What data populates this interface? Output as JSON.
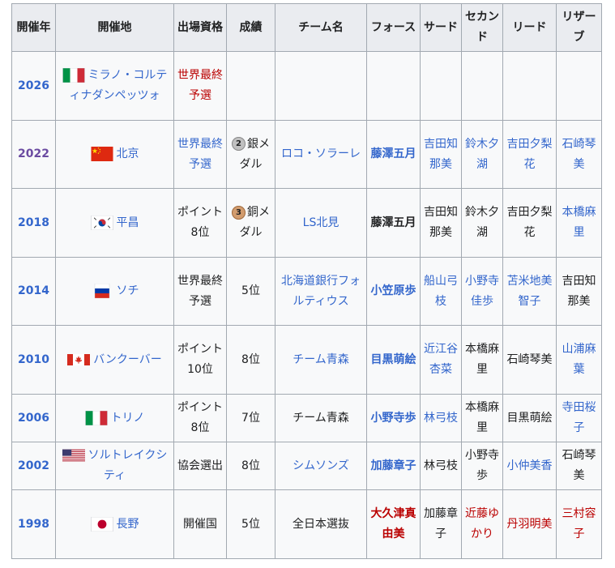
{
  "headers": [
    "開催年",
    "開催地",
    "出場資格",
    "成績",
    "チーム名",
    "フォース",
    "サード",
    "セカンド",
    "リード",
    "リザーブ"
  ],
  "rows": [
    {
      "year": "2026",
      "flag": "italy-flag-icon",
      "venue": "ミラノ・コルティナダンペッツォ",
      "qual": "世界最終予選",
      "result": "",
      "medal": "",
      "team": "",
      "fourth": "",
      "third": "",
      "second": "",
      "lead": "",
      "reserve": ""
    },
    {
      "year": "2022",
      "flag": "china-flag-icon",
      "venue": "北京",
      "qual": "世界最終予選",
      "result": "銀メダル",
      "medal": "2",
      "team": "ロコ・ソラーレ",
      "fourth": "藤澤五月",
      "third": "吉田知那美",
      "second": "鈴木夕湖",
      "lead": "吉田夕梨花",
      "reserve": "石崎琴美"
    },
    {
      "year": "2018",
      "flag": "korea-flag-icon",
      "venue": "平昌",
      "qual": "ポイント8位",
      "result": "銅メダル",
      "medal": "3",
      "team": "LS北見",
      "fourth": "藤澤五月",
      "third": "吉田知那美",
      "second": "鈴木夕湖",
      "lead": "吉田夕梨花",
      "reserve": "本橋麻里"
    },
    {
      "year": "2014",
      "flag": "russia-flag-icon",
      "venue": "ソチ",
      "qual": "世界最終予選",
      "result": "5位",
      "medal": "",
      "team": "北海道銀行フォルティウス",
      "fourth": "小笠原歩",
      "third": "船山弓枝",
      "second": "小野寺佳歩",
      "lead": "苫米地美智子",
      "reserve": "吉田知那美"
    },
    {
      "year": "2010",
      "flag": "canada-flag-icon",
      "venue": "バンクーバー",
      "qual": "ポイント10位",
      "result": "8位",
      "medal": "",
      "team": "チーム青森",
      "fourth": "目黒萌絵",
      "third": "近江谷杏菜",
      "second": "本橋麻里",
      "lead": "石崎琴美",
      "reserve": "山浦麻葉"
    },
    {
      "year": "2006",
      "flag": "italy-flag-icon",
      "venue": "トリノ",
      "qual": "ポイント8位",
      "result": "7位",
      "medal": "",
      "team": "チーム青森",
      "fourth": "小野寺歩",
      "third": "林弓枝",
      "second": "本橋麻里",
      "lead": "目黒萌絵",
      "reserve": "寺田桜子"
    },
    {
      "year": "2002",
      "flag": "usa-flag-icon",
      "venue": "ソルトレイクシティ",
      "qual": "協会選出",
      "result": "8位",
      "medal": "",
      "team": "シムソンズ",
      "fourth": "加藤章子",
      "third": "林弓枝",
      "second": "小野寺歩",
      "lead": "小仲美香",
      "reserve": "石崎琴美"
    },
    {
      "year": "1998",
      "flag": "japan-flag-icon",
      "venue": "長野",
      "qual": "開催国",
      "result": "5位",
      "medal": "",
      "team": "全日本選抜",
      "fourth": "大久津真由美",
      "third": "加藤章子",
      "second": "近藤ゆかり",
      "lead": "丹羽明美",
      "reserve": "三村容子"
    }
  ],
  "colors": {
    "link": "#3366cc",
    "visited": "#6b4ba1",
    "redlink": "#ba0000",
    "header_bg": "#eaecf0",
    "cell_bg": "#f8f9fa",
    "border": "#a2a9b1"
  }
}
